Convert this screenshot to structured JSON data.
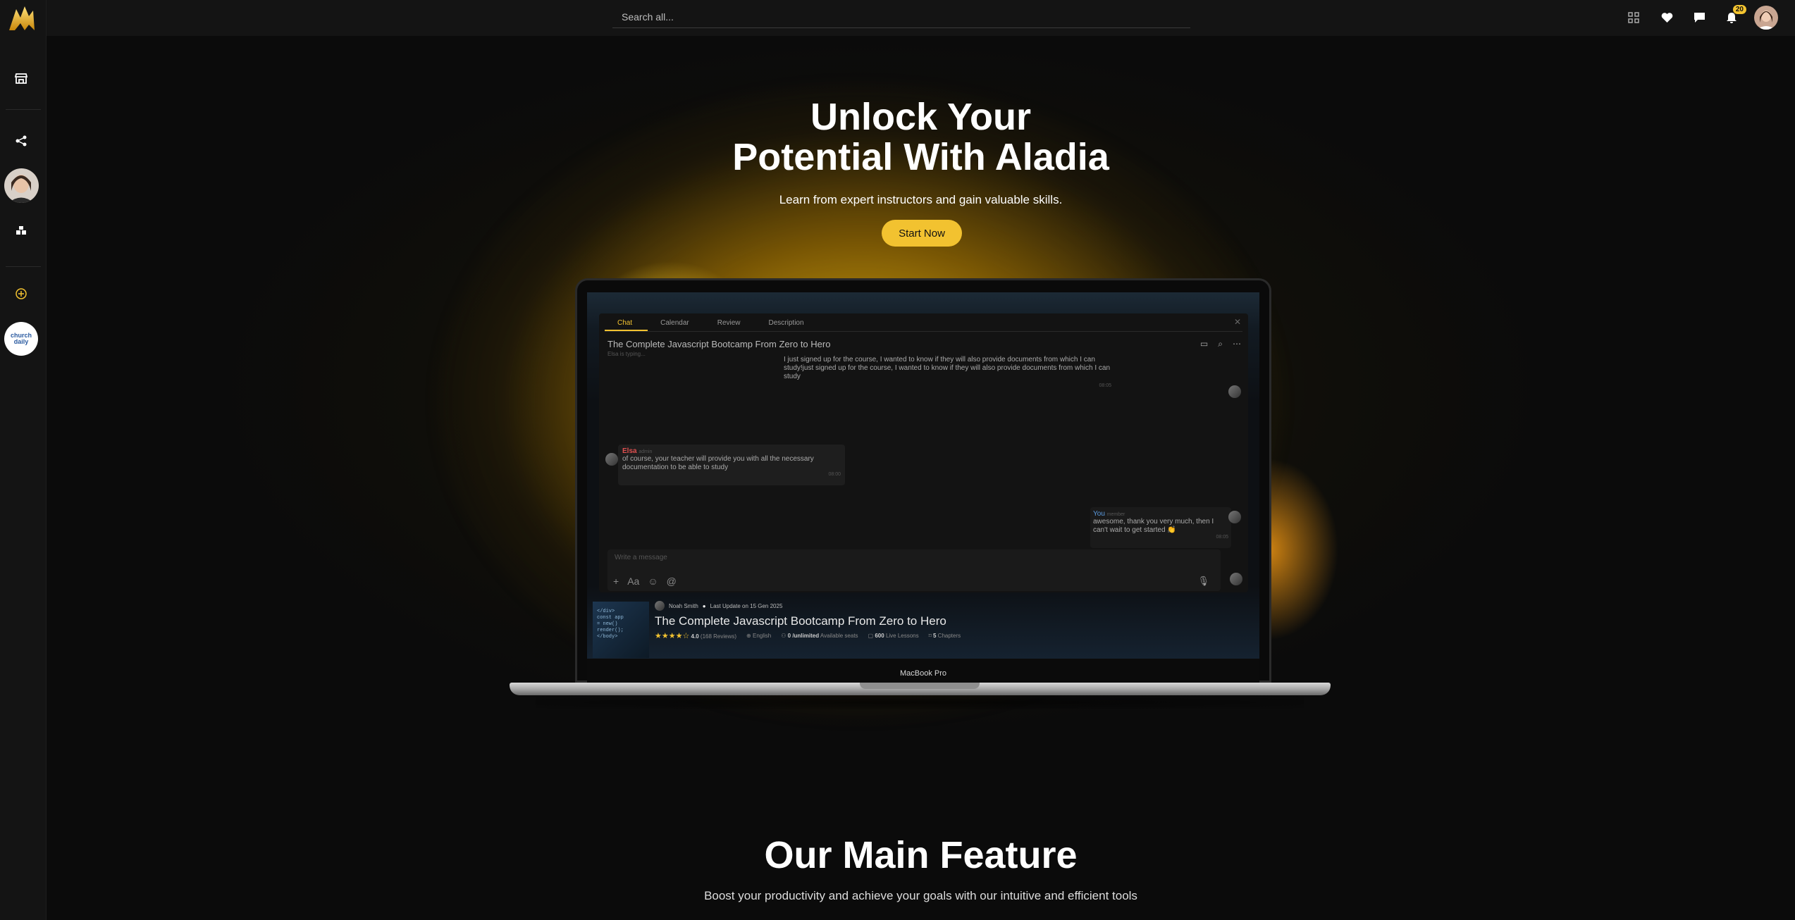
{
  "brand": {
    "accent": "#f2c230",
    "logo": "aladia-logo"
  },
  "topbar": {
    "search_placeholder": "Search all...",
    "notification_count": "20",
    "icons": [
      "grid-icon",
      "heart-icon",
      "chat-icon",
      "bell-icon"
    ]
  },
  "sidebar": {
    "items": [
      "store-icon",
      "share-icon",
      "user-avatar",
      "boxes-icon",
      "add-circle-icon",
      "organization-avatar"
    ],
    "org_label": "church daily"
  },
  "hero": {
    "title_line1": "Unlock Your",
    "title_line2": "Potential With Aladia",
    "subtitle": "Learn from expert instructors and gain valuable skills.",
    "cta": "Start Now"
  },
  "laptop": {
    "label": "MacBook Pro",
    "tabs": [
      "Chat",
      "Calendar",
      "Review",
      "Description"
    ],
    "course_title": "The Complete Javascript Bootcamp From Zero to Hero",
    "typing": "Elsa is typing...",
    "messages": {
      "right1_text": "I just signed up for the course, I wanted to know if they will also provide documents from which I can study!just signed up for the course, I wanted to know if they will also provide documents from which I can study",
      "right1_time": "08:05",
      "left_name": "Elsa",
      "left_role": "admin",
      "left_text": "of course, your teacher will provide you with all the necessary documentation to be able to study",
      "left_time": "08:00",
      "right2_name": "You",
      "right2_role": "member",
      "right2_text": "awesome, thank you very much, then I can't wait to get started 👏",
      "right2_time": "08:05"
    },
    "composer_placeholder": "Write a message",
    "card": {
      "author": "Noah Smith",
      "update": "Last Update on 15 Gen 2025",
      "title": "The Complete Javascript Bootcamp From Zero to Hero",
      "rating": "4.0",
      "reviews": "(168 Reviews)",
      "language": "English",
      "seats_value": "0 /unlimited",
      "seats_label": "Available seats",
      "lessons_value": "600",
      "lessons_label": "Live Lessons",
      "chapters_value": "5",
      "chapters_label": "Chapters"
    }
  },
  "feature": {
    "title": "Our Main Feature",
    "subtitle": "Boost your productivity and achieve your goals with our intuitive and efficient tools"
  }
}
